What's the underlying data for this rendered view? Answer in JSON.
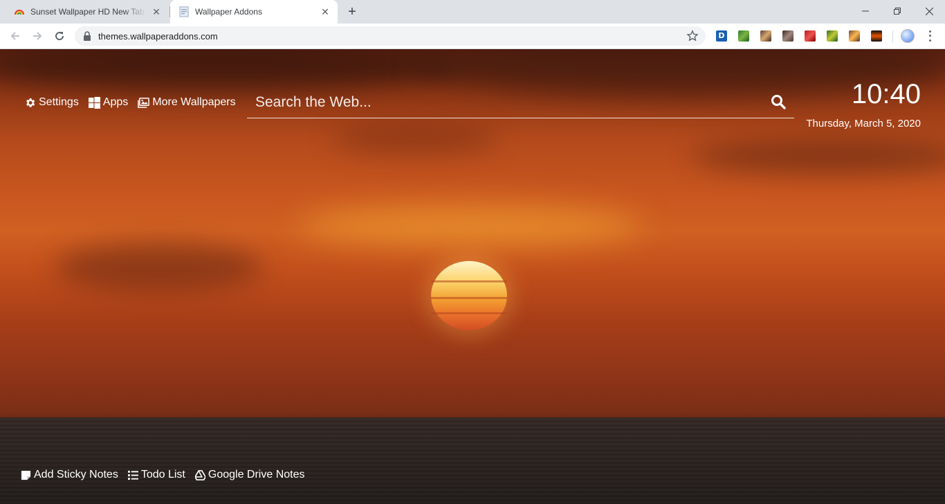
{
  "browser": {
    "tabs": [
      {
        "title": "Sunset Wallpaper HD New Tab Theme",
        "active": false
      },
      {
        "title": "Wallpaper Addons",
        "active": true
      }
    ],
    "url": "themes.wallpaperaddons.com",
    "extension_letter": "D"
  },
  "page": {
    "top_links": {
      "settings": "Settings",
      "apps": "Apps",
      "more_wallpapers": "More Wallpapers"
    },
    "search": {
      "placeholder": "Search the Web..."
    },
    "clock": {
      "time": "10:40",
      "date": "Thursday, March 5, 2020"
    },
    "bottom_links": {
      "sticky_notes": "Add Sticky Notes",
      "todo": "Todo List",
      "drive_notes": "Google Drive Notes"
    }
  },
  "icons": {
    "settings": "gear-icon",
    "apps": "windows-grid-icon",
    "more_wallpapers": "images-icon",
    "search": "magnifier-icon",
    "sticky_notes": "sticky-note-icon",
    "todo": "list-icon",
    "drive_notes": "google-drive-icon"
  },
  "colors": {
    "tabstrip": "#dee1e6",
    "toolbar": "#ffffff",
    "omnibox": "#f1f3f4",
    "overlay_text": "#ffffff",
    "sky_mid": "#d06022",
    "sea": "#2c2624"
  }
}
